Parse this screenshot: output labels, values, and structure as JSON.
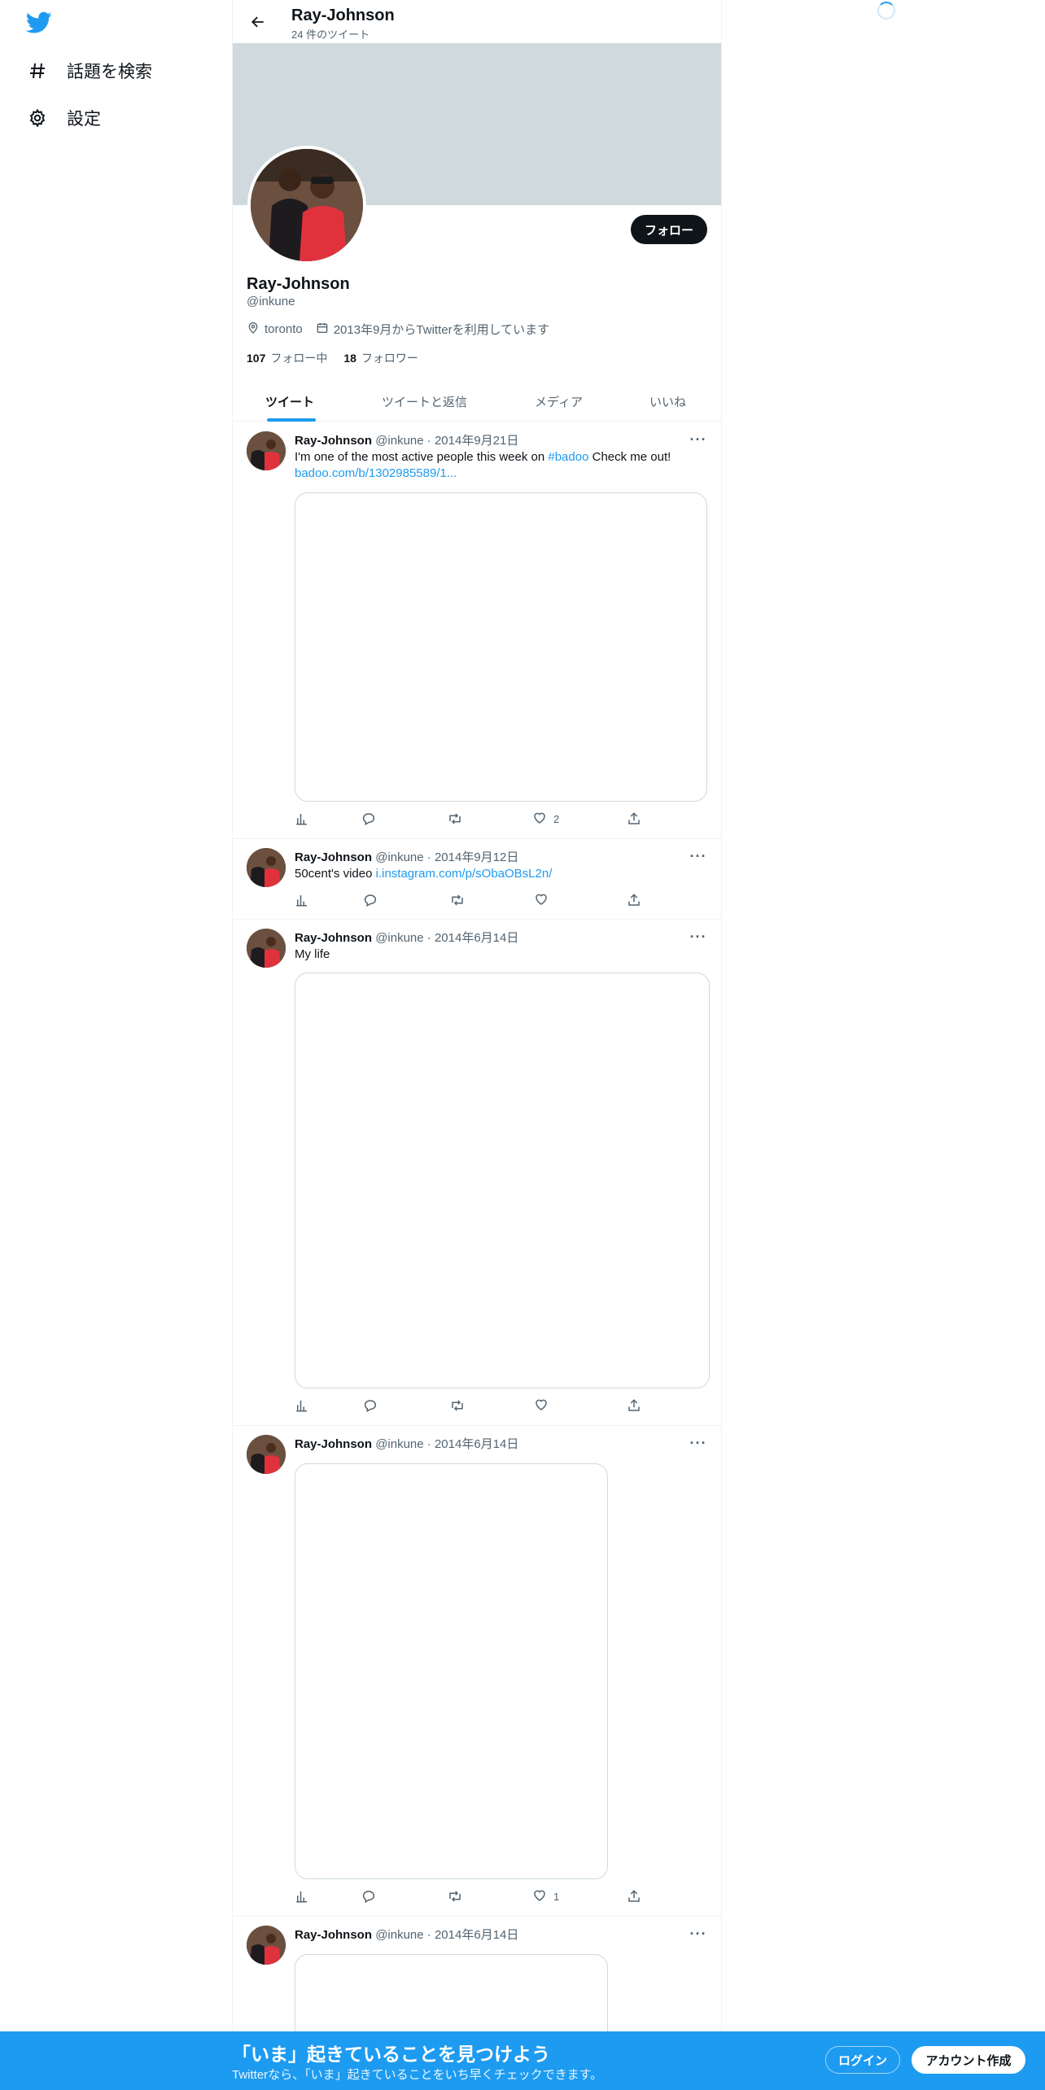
{
  "app": {
    "brand": "Twitter",
    "accent": "#1d9bf0"
  },
  "sidebar": {
    "items": [
      {
        "label": "話題を検索",
        "icon": "hashtag-icon"
      },
      {
        "label": "設定",
        "icon": "gear-icon"
      }
    ]
  },
  "header": {
    "name": "Ray-Johnson",
    "tweet_count": "24 件のツイート"
  },
  "profile": {
    "name": "Ray-Johnson",
    "handle": "@inkune",
    "location": "toronto",
    "joined": "2013年9月からTwitterを利用しています",
    "following_count": "107",
    "following_label": "フォロー中",
    "followers_count": "18",
    "followers_label": "フォロワー",
    "follow_button": "フォロー"
  },
  "tabs": [
    {
      "label": "ツイート",
      "active": true
    },
    {
      "label": "ツイートと返信",
      "active": false
    },
    {
      "label": "メディア",
      "active": false
    },
    {
      "label": "いいね",
      "active": false
    }
  ],
  "tweets": [
    {
      "name": "Ray-Johnson",
      "handle": "@inkune",
      "date": "2014年9月21日",
      "text_before": "I'm one of the most active people this week on ",
      "hashtag": "#badoo",
      "text_after": " Check me out! ",
      "link": "badoo.com/b/1302985589/1...",
      "like_count": "2"
    },
    {
      "name": "Ray-Johnson",
      "handle": "@inkune",
      "date": "2014年9月12日",
      "text_before": "50cent's video ",
      "link": "i.instagram.com/p/sObaOBsL2n/",
      "like_count": ""
    },
    {
      "name": "Ray-Johnson",
      "handle": "@inkune",
      "date": "2014年6月14日",
      "text_before": "My life",
      "like_count": ""
    },
    {
      "name": "Ray-Johnson",
      "handle": "@inkune",
      "date": "2014年6月14日",
      "like_count": "1"
    },
    {
      "name": "Ray-Johnson",
      "handle": "@inkune",
      "date": "2014年6月14日"
    }
  ],
  "bottom_bar": {
    "title": "「いま」起きていることを見つけよう",
    "subtitle": "Twitterなら、「いま」起きていることをいち早くチェックできます。",
    "login": "ログイン",
    "signup": "アカウント作成"
  }
}
